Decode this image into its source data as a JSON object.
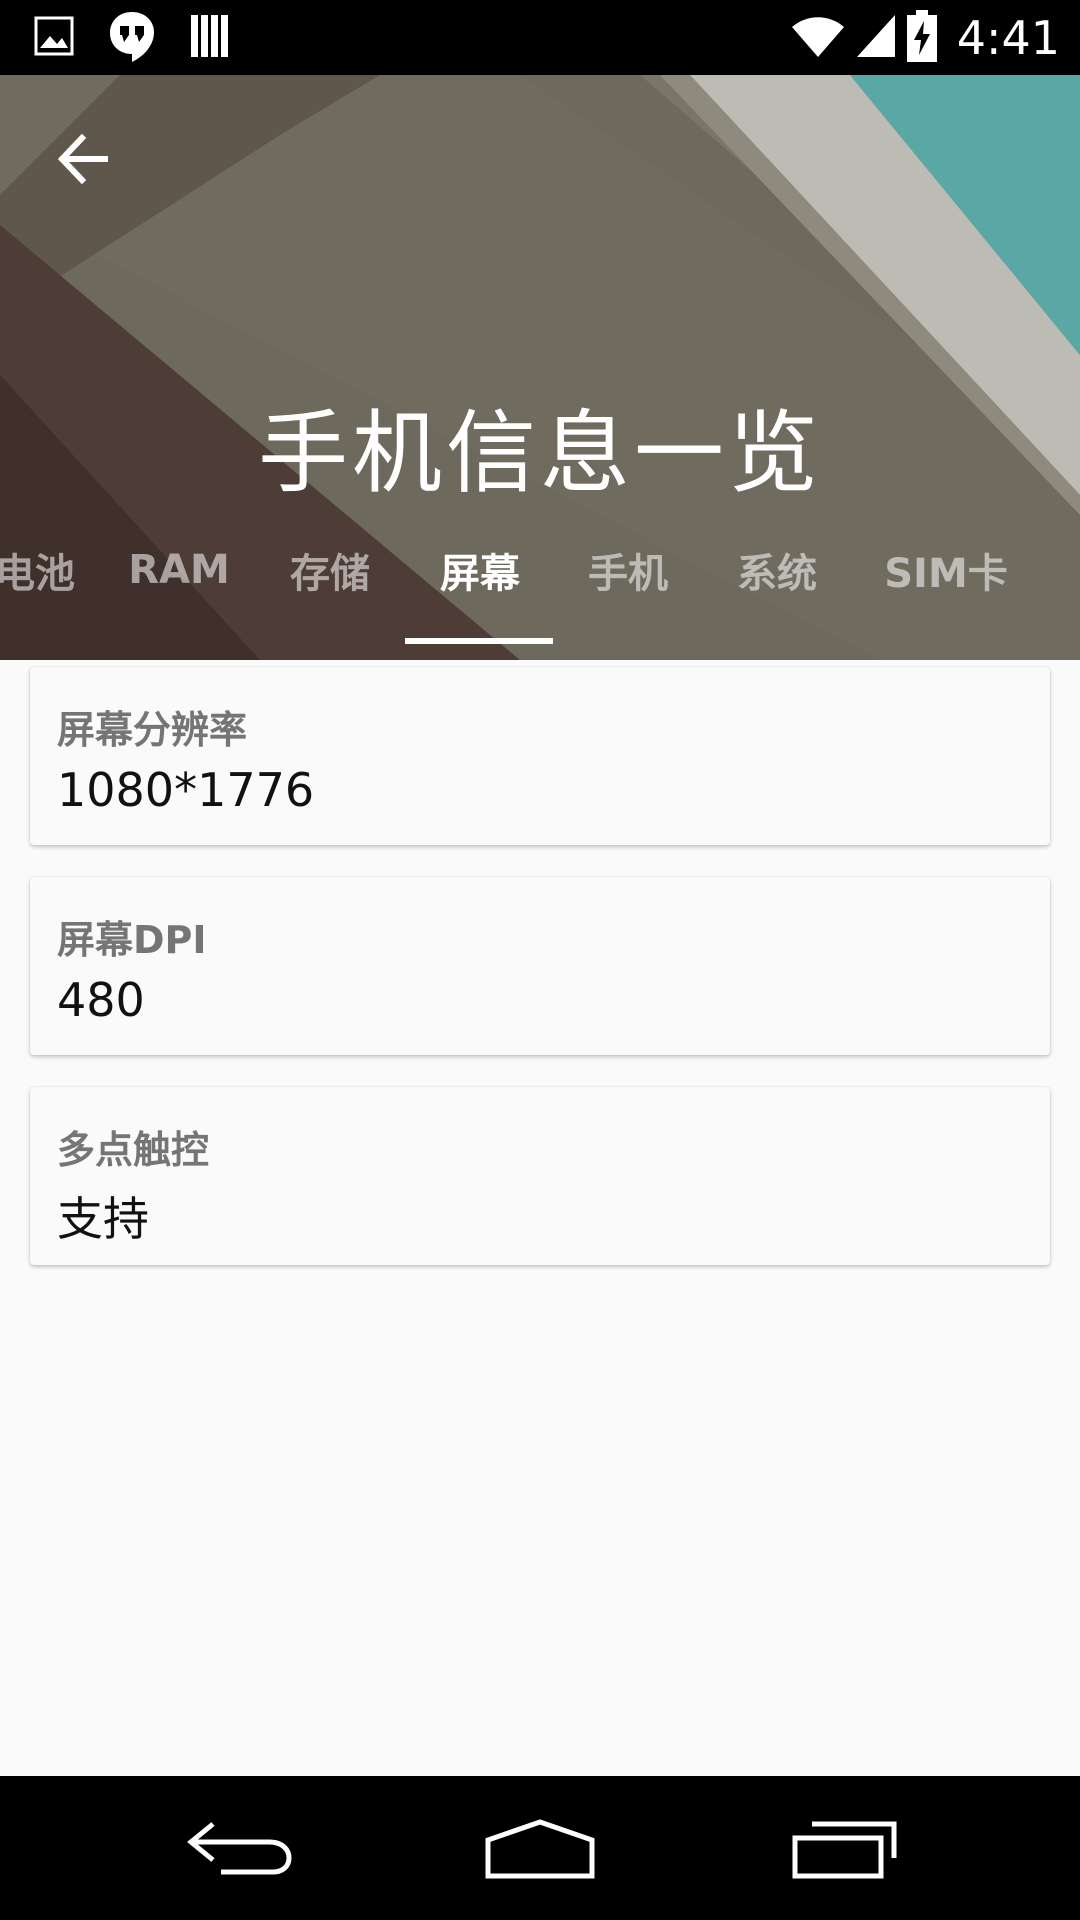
{
  "status_bar": {
    "time": "4:41",
    "left_icons": [
      "image-icon",
      "hangouts-icon",
      "books-icon"
    ],
    "right_icons": [
      "wifi-icon",
      "cell-signal-icon",
      "battery-charging-icon"
    ]
  },
  "header": {
    "title": "手机信息一览",
    "back_icon": "arrow-back-icon",
    "colors": {
      "accent_teal": "#5aa8a6",
      "bg_dark": "#4e3d36",
      "bg_mid": "#6f6a5e"
    }
  },
  "tabs": [
    {
      "label": "电池",
      "active": false
    },
    {
      "label": "RAM",
      "active": false
    },
    {
      "label": "存储",
      "active": false
    },
    {
      "label": "屏幕",
      "active": true
    },
    {
      "label": "手机",
      "active": false
    },
    {
      "label": "系统",
      "active": false
    },
    {
      "label": "SIM卡",
      "active": false
    }
  ],
  "cards": [
    {
      "label": "屏幕分辨率",
      "value": "1080*1776"
    },
    {
      "label": "屏幕DPI",
      "value": "480"
    },
    {
      "label": "多点触控",
      "value": "支持"
    }
  ],
  "nav_bar": {
    "icons": [
      "back-icon",
      "home-icon",
      "recents-icon"
    ]
  }
}
